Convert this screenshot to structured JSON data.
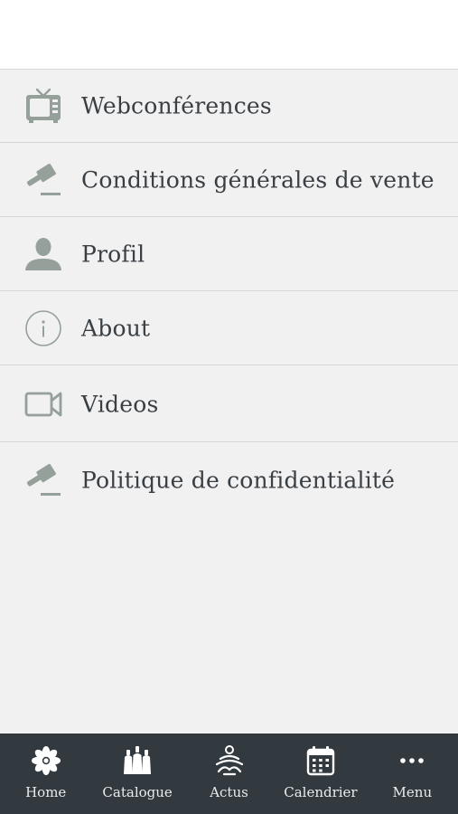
{
  "colors": {
    "icon_gray": "#96a09a",
    "text": "#3a3f44",
    "background": "#f1f1f1",
    "tab_bar": "#323a40",
    "tab_text": "#e9ecee"
  },
  "menu": {
    "items": [
      {
        "label": "Webconférences",
        "icon": "tv-icon"
      },
      {
        "label": "Conditions générales de vente",
        "icon": "gavel-icon"
      },
      {
        "label": "Profil",
        "icon": "user-icon"
      },
      {
        "label": "About",
        "icon": "info-icon"
      },
      {
        "label": "Videos",
        "icon": "video-camera-icon"
      },
      {
        "label": "Politique de confidentialité",
        "icon": "gavel-icon"
      }
    ]
  },
  "tabbar": {
    "tabs": [
      {
        "label": "Home",
        "icon": "flower-icon"
      },
      {
        "label": "Catalogue",
        "icon": "bottles-icon"
      },
      {
        "label": "Actus",
        "icon": "meditation-icon"
      },
      {
        "label": "Calendrier",
        "icon": "calendar-icon"
      },
      {
        "label": "Menu",
        "icon": "more-icon"
      }
    ]
  }
}
